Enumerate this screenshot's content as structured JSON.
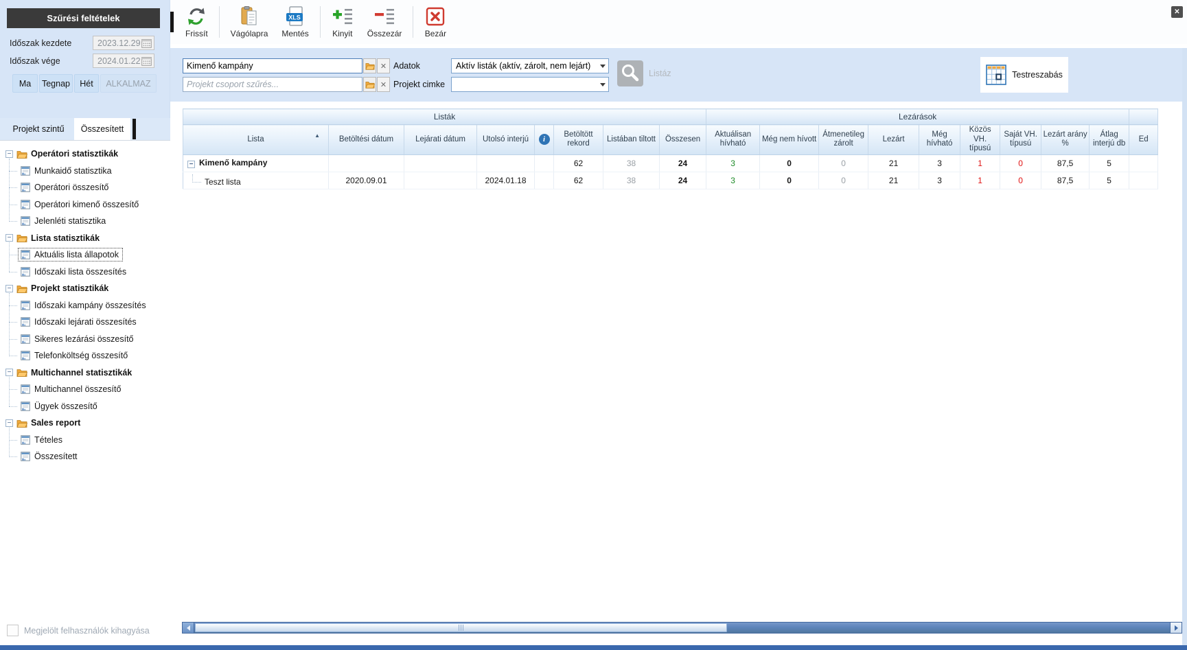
{
  "icons": {
    "collapse": "−",
    "sort_asc": "▲",
    "close": "✕",
    "clear": "✕",
    "info": "i"
  },
  "sidebar": {
    "filter_title": "Szűrési feltételek",
    "period_start": {
      "label": "Időszak kezdete",
      "value": "2023.12.29"
    },
    "period_end": {
      "label": "Időszak vége",
      "value": "2024.01.22"
    },
    "quick": {
      "ma": "Ma",
      "tegnap": "Tegnap",
      "het": "Hét",
      "alkalmaz": "ALKALMAZ"
    },
    "tabs": {
      "project": "Projekt szintű",
      "summary": "Összesített"
    },
    "tree": [
      {
        "label": "Operátori statisztikák",
        "children": [
          "Munkaidő statisztika",
          "Operátori összesítő",
          "Operátori kimenő összesítő",
          "Jelenléti statisztika"
        ]
      },
      {
        "label": "Lista statisztikák",
        "children": [
          "Aktuális lista állapotok",
          "Időszaki lista összesítés"
        ]
      },
      {
        "label": "Projekt statisztikák",
        "children": [
          "Időszaki kampány összesítés",
          "Időszaki lejárati összesítés",
          "Sikeres lezárási összesítő",
          "Telefonköltség összesítő"
        ]
      },
      {
        "label": "Multichannel statisztikák",
        "children": [
          "Multichannel összesítő",
          "Ügyek összesítő"
        ]
      },
      {
        "label": "Sales report",
        "children": [
          "Tételes",
          "Összesített"
        ]
      }
    ],
    "selected_item": "Aktuális lista állapotok",
    "skip_users_label": "Megjelölt felhasználók kihagyása"
  },
  "toolbar": {
    "frissit": "Frissít",
    "vagolapra": "Vágólapra",
    "mentes": "Mentés",
    "kinyit": "Kinyit",
    "osszezar": "Összezár",
    "bezar": "Bezár",
    "xls_badge": "XLS"
  },
  "filters": {
    "campaign_value": "Kimenő kampány",
    "project_group_placeholder": "Projekt csoport szűrés...",
    "adatok_label": "Adatok",
    "adatok_value": "Aktív listák (aktív, zárolt, nem lejárt)",
    "cimke_label": "Projekt cimke",
    "cimke_value": "",
    "listaz_label": "Listáz",
    "testreszabas_label": "Testreszabás"
  },
  "grid": {
    "groups": {
      "listak": "Listák",
      "lezarasok": "Lezárások"
    },
    "columns": [
      "Lista",
      "Betöltési dátum",
      "Lejárati dátum",
      "Utolsó interjú",
      "",
      "Betöltött rekord",
      "Listában tiltott",
      "Összesen",
      "Aktuálisan hívható",
      "Még nem hívott",
      "Átmenetileg zárolt",
      "Lezárt",
      "Még hívható",
      "Közös VH. típusú",
      "Saját VH. típusú",
      "Lezárt arány %",
      "Átlag interjú db",
      "Ed"
    ],
    "rows": [
      {
        "type": "group",
        "cells": [
          "Kimenő kampány",
          "",
          "",
          "",
          "",
          "62",
          "38",
          "24",
          "3",
          "0",
          "0",
          "21",
          "3",
          "1",
          "0",
          "87,5",
          "5",
          ""
        ]
      },
      {
        "type": "leaf",
        "cells": [
          "Teszt lista",
          "2020.09.01",
          "",
          "2024.01.18",
          "",
          "62",
          "38",
          "24",
          "3",
          "0",
          "0",
          "21",
          "3",
          "1",
          "0",
          "87,5",
          "5",
          ""
        ]
      }
    ]
  },
  "colors": {
    "positive_green": "#1d8a27",
    "negative_red": "#e01313",
    "muted_gray": "#9aa0a6",
    "accent_blue": "#2e75b6",
    "scroll_blue": "#5d84bb"
  }
}
